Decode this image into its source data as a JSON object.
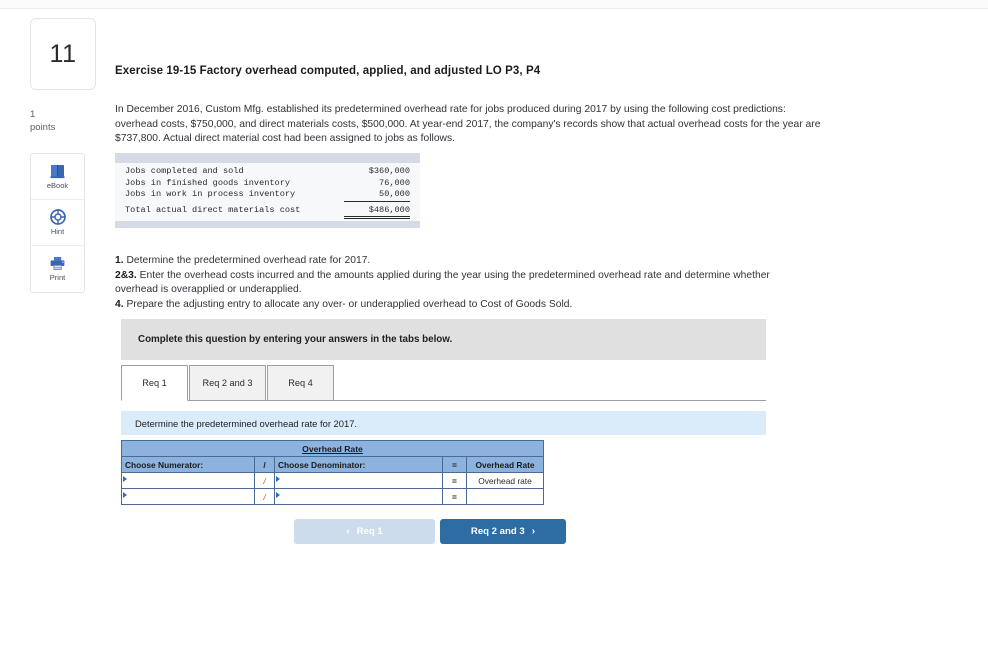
{
  "question": {
    "number": "11",
    "points_value": "1",
    "points_label": "points"
  },
  "tools": [
    {
      "label": "eBook",
      "icon": "ebook-icon"
    },
    {
      "label": "Hint",
      "icon": "hint-icon"
    },
    {
      "label": "Print",
      "icon": "print-icon"
    }
  ],
  "exercise": {
    "title": "Exercise 19-15 Factory overhead computed, applied, and adjusted LO P3, P4",
    "intro": "In December 2016, Custom Mfg. established its predetermined overhead rate for jobs produced during 2017 by using the following cost predictions: overhead costs, $750,000, and direct materials costs, $500,000. At year-end 2017, the company's records show that actual overhead costs for the year are $737,800. Actual direct material cost had been assigned to jobs as follows."
  },
  "cost_table": {
    "rows": [
      {
        "label": "Jobs completed and sold",
        "value": "$360,000"
      },
      {
        "label": "Jobs in finished goods inventory",
        "value": "76,000"
      },
      {
        "label": "Jobs in work in process inventory",
        "value": "50,000"
      }
    ],
    "total": {
      "label": "Total actual direct materials cost",
      "value": "$486,000"
    }
  },
  "requirements": {
    "r1_num": "1.",
    "r1_text": " Determine the predetermined overhead rate for 2017.",
    "r2_num": "2&3.",
    "r2_text": " Enter the overhead costs incurred and the amounts applied during the year using the predetermined overhead rate and determine whether overhead is overapplied or underapplied.",
    "r4_num": "4.",
    "r4_text": " Prepare the adjusting entry to allocate any over- or underapplied overhead to Cost of Goods Sold."
  },
  "banner": {
    "text": "Complete this question by entering your answers in the tabs below."
  },
  "tabs": [
    {
      "label": "Req 1",
      "active": true
    },
    {
      "label": "Req 2 and 3",
      "active": false
    },
    {
      "label": "Req 4",
      "active": false
    }
  ],
  "sub_instruction": {
    "text": "Determine the predetermined overhead rate for 2017."
  },
  "answer_grid": {
    "title": "Overhead Rate",
    "headers": {
      "numerator": "Choose Numerator:",
      "divider": "/",
      "denominator": "Choose Denominator:",
      "equals": "=",
      "result": "Overhead Rate"
    },
    "rows": [
      {
        "numerator_value": "",
        "operator": "/",
        "denominator_value": "",
        "equals": "=",
        "result": "Overhead rate"
      },
      {
        "numerator_value": "",
        "operator": "/",
        "denominator_value": "",
        "equals": "=",
        "result": ""
      }
    ]
  },
  "nav": {
    "prev_label": "Req 1",
    "prev_chevron": "‹",
    "next_label": "Req 2 and 3",
    "next_chevron": "›"
  },
  "colors": {
    "grid_header_blue": "#8cb3de",
    "grid_border": "#4a6b95",
    "banner_gray": "#e0e0e0",
    "sub_instruction_blue": "#daebf9",
    "next_button_blue": "#2e6da4",
    "prev_button_blue": "#ccdced",
    "data_band": "#d5dbe4"
  }
}
